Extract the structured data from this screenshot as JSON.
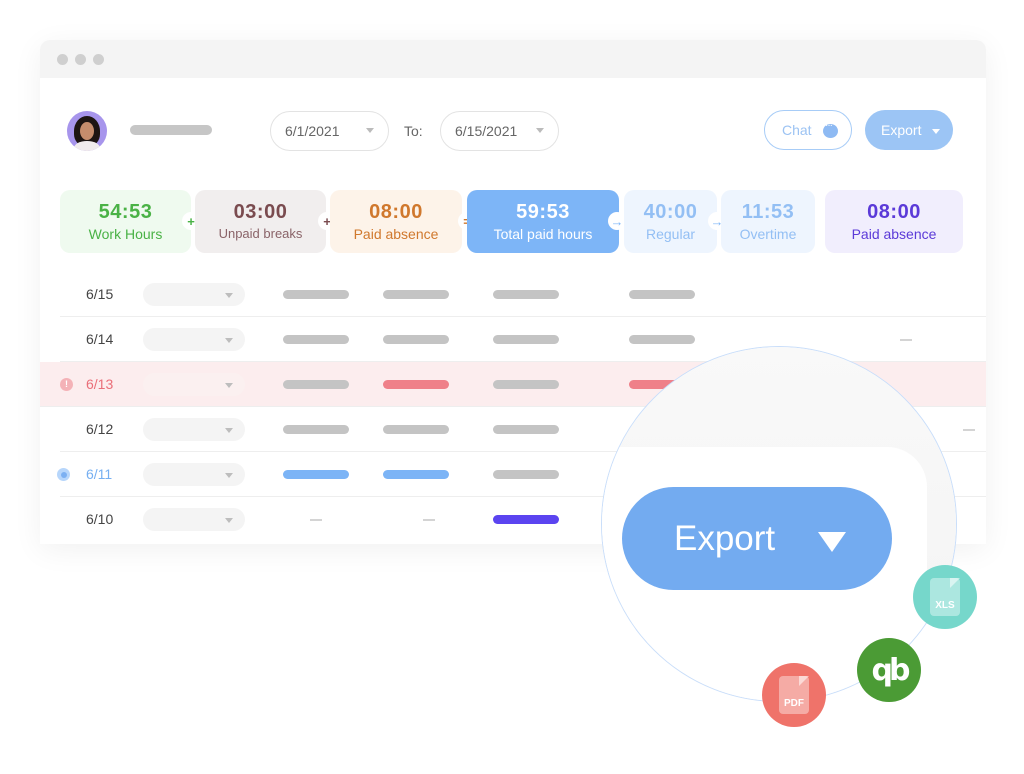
{
  "window": {
    "controls": [
      "close",
      "minimize",
      "maximize"
    ]
  },
  "header": {
    "avatar_icon": "user-avatar",
    "date_from": "6/1/2021",
    "to_label": "To:",
    "date_to": "6/15/2021",
    "chat_label": "Chat",
    "chat_icon": "chat-bubble-icon",
    "export_label": "Export"
  },
  "summary": {
    "work_hours": {
      "value": "54:53",
      "label": "Work Hours"
    },
    "op1": "+",
    "unpaid_breaks": {
      "value": "03:00",
      "label": "Unpaid breaks"
    },
    "op2": "+",
    "paid_absence": {
      "value": "08:00",
      "label": "Paid absence"
    },
    "op3": "=",
    "total_paid": {
      "value": "59:53",
      "label": "Total paid hours"
    },
    "op4": "→",
    "regular": {
      "value": "40:00",
      "label": "Regular"
    },
    "op5": "→",
    "overtime": {
      "value": "11:53",
      "label": "Overtime"
    },
    "paid_absence_2": {
      "value": "08:00",
      "label": "Paid absence"
    },
    "colors": {
      "work": "#4ab246",
      "unpaid": "#7a4b4f",
      "paid": "#d0782d",
      "total_bg": "#7db5f7",
      "regular": "#93bff4",
      "absence": "#5b3ad8"
    }
  },
  "rows": [
    {
      "date": "6/15",
      "status": "normal"
    },
    {
      "date": "6/14",
      "status": "normal"
    },
    {
      "date": "6/13",
      "status": "alert",
      "icon": "alert-icon",
      "icon_text": "!"
    },
    {
      "date": "6/12",
      "status": "normal"
    },
    {
      "date": "6/11",
      "status": "info",
      "icon": "info-icon"
    },
    {
      "date": "6/10",
      "status": "normal"
    }
  ],
  "magnifier": {
    "export_label": "Export"
  },
  "export_formats": [
    {
      "name": "XLS",
      "color": "#76d7cb"
    },
    {
      "name": "QuickBooks",
      "glyph": "qb",
      "color": "#4b9b35"
    },
    {
      "name": "PDF",
      "color": "#ef736a"
    }
  ]
}
